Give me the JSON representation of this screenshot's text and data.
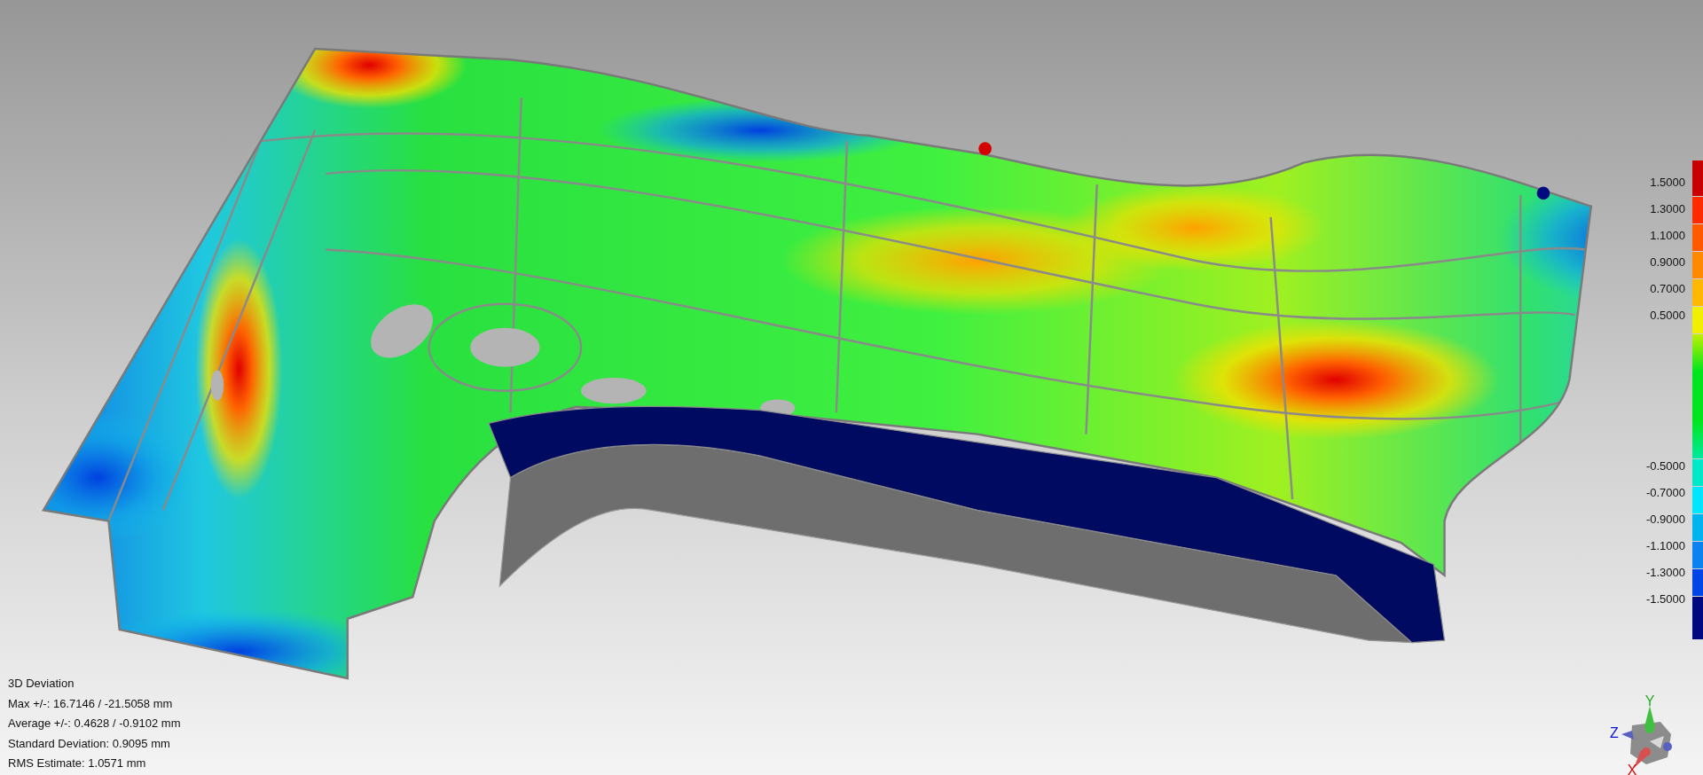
{
  "color_scale": {
    "upper_labels": [
      "1.5000",
      "1.3000",
      "1.1000",
      "0.9000",
      "0.7000",
      "0.5000"
    ],
    "lower_labels": [
      "-0.5000",
      "-0.7000",
      "-0.9000",
      "-1.1000",
      "-1.3000",
      "-1.5000"
    ],
    "upper_bands": [
      {
        "color": "#c80000"
      },
      {
        "color": "#ff2a00"
      },
      {
        "color": "#ff5a00"
      },
      {
        "color": "#ff8a00"
      },
      {
        "color": "#ffb800"
      },
      {
        "color": "#f0f000"
      }
    ],
    "middle_band": {
      "color": "#00e61e"
    },
    "lower_bands": [
      {
        "color": "#00e8c8"
      },
      {
        "color": "#00e6ff"
      },
      {
        "color": "#00b4f0"
      },
      {
        "color": "#0a82f0"
      },
      {
        "color": "#0046e6"
      },
      {
        "color": "#000a80"
      }
    ]
  },
  "statistics": [
    "3D Deviation",
    "Max +/-: 16.7146 / -21.5058 mm",
    "Average +/-: 0.4628 / -0.9102 mm",
    "Standard Deviation: 0.9095 mm",
    "RMS Estimate: 1.0571 mm"
  ],
  "axis_labels": {
    "y": "Y",
    "z": "Z",
    "x": "X"
  }
}
